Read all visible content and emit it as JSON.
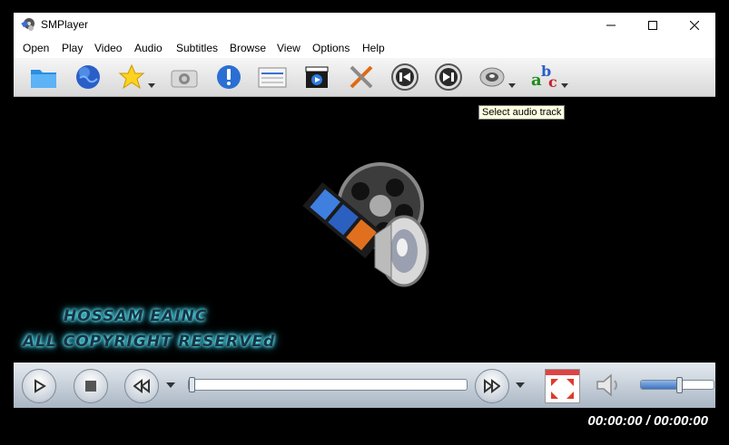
{
  "window": {
    "title": "SMPlayer"
  },
  "menu": [
    "Open",
    "Play",
    "Video",
    "Audio",
    "Subtitles",
    "Browse",
    "View",
    "Options",
    "Help"
  ],
  "toolbar": {
    "buttons": [
      "open-folder",
      "open-url",
      "favorites",
      "screenshot",
      "info",
      "playlist",
      "video-equalizer",
      "preferences",
      "previous",
      "next",
      "audio-track",
      "subtitles"
    ]
  },
  "tooltip": "Select audio track",
  "watermark": {
    "line1": "HOSSAM EAINC",
    "line2": "ALL COPYRIGHT RESERVEd"
  },
  "player": {
    "time": "00:00:00 / 00:00:00",
    "progress": 0,
    "volume": 0.52
  }
}
